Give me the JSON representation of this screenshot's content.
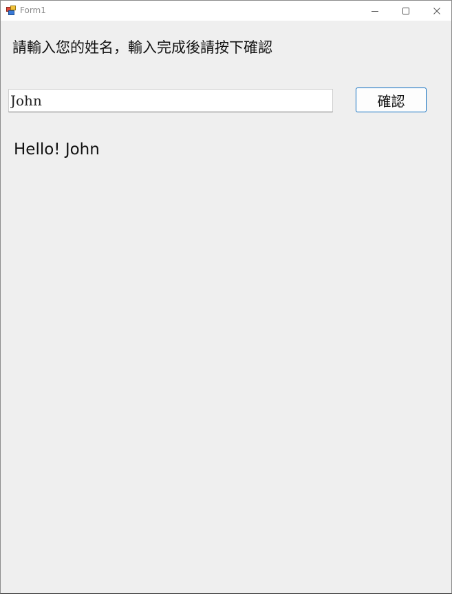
{
  "window": {
    "title": "Form1",
    "minimize_icon": "minimize-icon",
    "maximize_icon": "maximize-icon",
    "close_icon": "close-icon",
    "app_icon": "winforms-app-icon"
  },
  "form": {
    "prompt": "請輸入您的姓名，輸入完成後請按下確認",
    "name_input_value": "John",
    "confirm_label": "確認",
    "greeting": "Hello! John"
  },
  "colors": {
    "client_background": "#efefef",
    "button_border_accent": "#0a6cc0"
  }
}
